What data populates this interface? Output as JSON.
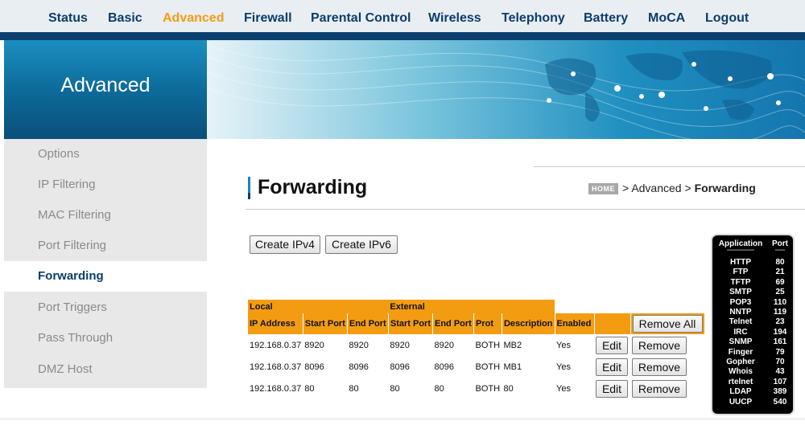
{
  "nav": {
    "items": [
      "Status",
      "Basic",
      "Advanced",
      "Firewall",
      "Parental Control",
      "Wireless",
      "Telephony",
      "Battery",
      "MoCA",
      "Logout"
    ],
    "active": "Advanced"
  },
  "banner": {
    "title": "Advanced"
  },
  "sidebar": {
    "items": [
      {
        "label": "Options"
      },
      {
        "label": "IP Filtering"
      },
      {
        "label": "MAC Filtering"
      },
      {
        "label": "Port Filtering"
      },
      {
        "label": "Forwarding",
        "active": true
      },
      {
        "label": "Port Triggers"
      },
      {
        "label": "Pass Through"
      },
      {
        "label": "DMZ Host"
      }
    ]
  },
  "page": {
    "title": "Forwarding",
    "breadcrumb": {
      "home": "HOME",
      "sep": ">",
      "parent": "Advanced",
      "current": "Forwarding"
    }
  },
  "buttons": {
    "create_ipv4": "Create IPv4",
    "create_ipv6": "Create IPv6",
    "remove_all": "Remove All",
    "edit": "Edit",
    "remove": "Remove"
  },
  "table": {
    "group_local": "Local",
    "group_external": "External",
    "columns": [
      "IP Address",
      "Start Port",
      "End Port",
      "Start Port",
      "End Port",
      "Prot",
      "Description",
      "Enabled"
    ],
    "rows": [
      {
        "ip": "192.168.0.37",
        "local_start": "8920",
        "local_end": "8920",
        "ext_start": "8920",
        "ext_end": "8920",
        "prot": "BOTH",
        "desc": "MB2",
        "enabled": "Yes"
      },
      {
        "ip": "192.168.0.37",
        "local_start": "8096",
        "local_end": "8096",
        "ext_start": "8096",
        "ext_end": "8096",
        "prot": "BOTH",
        "desc": "MB1",
        "enabled": "Yes"
      },
      {
        "ip": "192.168.0.37",
        "local_start": "80",
        "local_end": "80",
        "ext_start": "80",
        "ext_end": "80",
        "prot": "BOTH",
        "desc": "80",
        "enabled": "Yes"
      }
    ]
  },
  "ports": {
    "header_app": "Application",
    "header_port": "Port",
    "dash_app": "-----------------",
    "dash_port": "------",
    "list": [
      {
        "app": "HTTP",
        "port": "80"
      },
      {
        "app": "FTP",
        "port": "21"
      },
      {
        "app": "TFTP",
        "port": "69"
      },
      {
        "app": "SMTP",
        "port": "25"
      },
      {
        "app": "POP3",
        "port": "110"
      },
      {
        "app": "NNTP",
        "port": "119"
      },
      {
        "app": "Telnet",
        "port": "23"
      },
      {
        "app": "IRC",
        "port": "194"
      },
      {
        "app": "SNMP",
        "port": "161"
      },
      {
        "app": "Finger",
        "port": "79"
      },
      {
        "app": "Gopher",
        "port": "70"
      },
      {
        "app": "Whois",
        "port": "43"
      },
      {
        "app": "rtelnet",
        "port": "107"
      },
      {
        "app": "LDAP",
        "port": "389"
      },
      {
        "app": "UUCP",
        "port": "540"
      }
    ]
  },
  "colors": {
    "nav_text": "#0b3d6b",
    "active": "#f39c12",
    "header_orange": "#f39c12",
    "navy": "#0b3f6e"
  }
}
